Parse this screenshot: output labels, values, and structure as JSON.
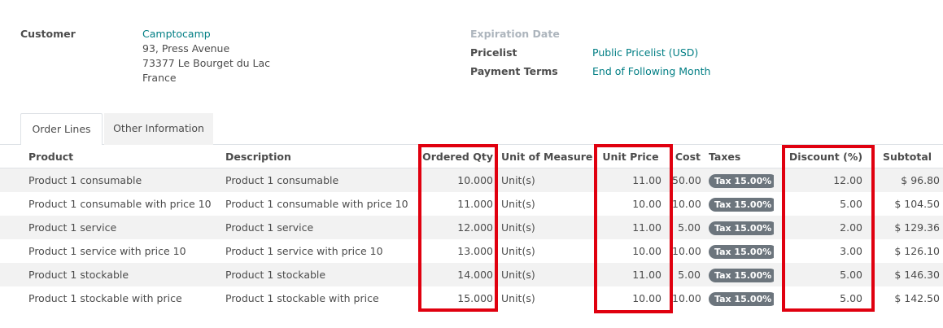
{
  "header": {
    "customer_label": "Customer",
    "customer_name": "Camptocamp",
    "address_line1": "93, Press Avenue",
    "address_line2": "73377 Le Bourget du Lac",
    "address_line3": "France",
    "expiration_label": "Expiration Date",
    "pricelist_label": "Pricelist",
    "pricelist_value": "Public Pricelist (USD)",
    "terms_label": "Payment Terms",
    "terms_value": "End of Following Month"
  },
  "tabs": [
    {
      "label": "Order Lines"
    },
    {
      "label": "Other Information"
    }
  ],
  "columns": {
    "product": "Product",
    "description": "Description",
    "qty": "Ordered Qty",
    "uom": "Unit of Measure",
    "price": "Unit Price",
    "cost": "Cost",
    "taxes": "Taxes",
    "discount": "Discount (%)",
    "subtotal": "Subtotal"
  },
  "rows": [
    {
      "product": "Product 1 consumable",
      "description": "Product 1 consumable",
      "qty": "10.000",
      "uom": "Unit(s)",
      "price": "11.00",
      "cost": "50.00",
      "tax": "Tax 15.00%",
      "discount": "12.00",
      "subtotal": "$ 96.80"
    },
    {
      "product": "Product 1 consumable with price 10",
      "description": "Product 1 consumable with price 10",
      "qty": "11.000",
      "uom": "Unit(s)",
      "price": "10.00",
      "cost": "10.00",
      "tax": "Tax 15.00%",
      "discount": "5.00",
      "subtotal": "$ 104.50"
    },
    {
      "product": "Product 1 service",
      "description": "Product 1 service",
      "qty": "12.000",
      "uom": "Unit(s)",
      "price": "11.00",
      "cost": "5.00",
      "tax": "Tax 15.00%",
      "discount": "2.00",
      "subtotal": "$ 129.36"
    },
    {
      "product": "Product 1 service with price 10",
      "description": "Product 1 service with price 10",
      "qty": "13.000",
      "uom": "Unit(s)",
      "price": "10.00",
      "cost": "10.00",
      "tax": "Tax 15.00%",
      "discount": "3.00",
      "subtotal": "$ 126.10"
    },
    {
      "product": "Product 1 stockable",
      "description": "Product 1 stockable",
      "qty": "14.000",
      "uom": "Unit(s)",
      "price": "11.00",
      "cost": "5.00",
      "tax": "Tax 15.00%",
      "discount": "5.00",
      "subtotal": "$ 146.30"
    },
    {
      "product": "Product 1 stockable with price",
      "description": "Product 1 stockable with price",
      "qty": "15.000",
      "uom": "Unit(s)",
      "price": "10.00",
      "cost": "10.00",
      "tax": "Tax 15.00%",
      "discount": "5.00",
      "subtotal": "$ 142.50"
    }
  ],
  "colors": {
    "link": "#017e84",
    "badge": "#6c757d",
    "highlight": "#e0000f",
    "stripe": "#f2f2f2"
  }
}
